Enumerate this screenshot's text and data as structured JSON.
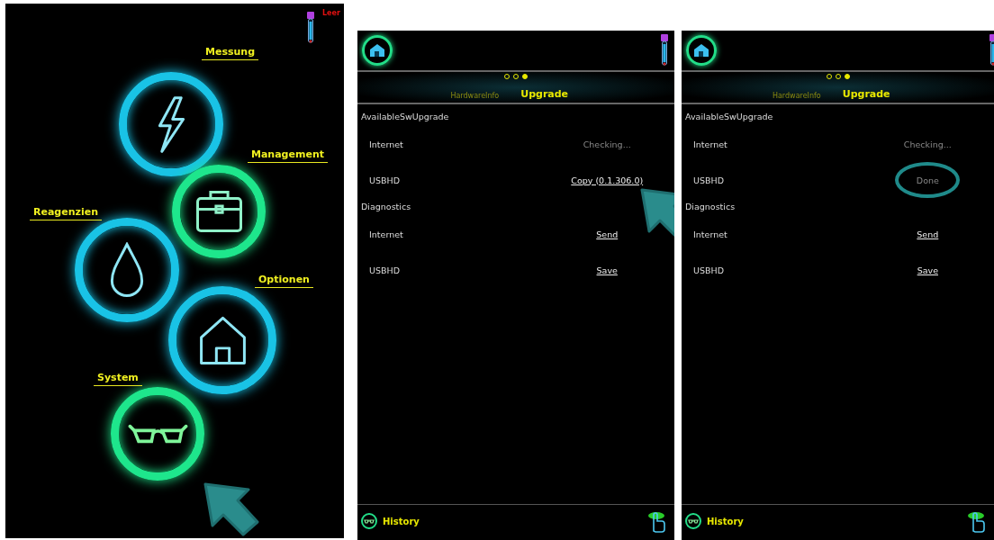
{
  "screens": [
    {
      "kind": "menu",
      "status_label": "Leer",
      "pointer": true,
      "menu": [
        {
          "label": "Messung",
          "color": "#19c3e6"
        },
        {
          "label": "Management",
          "color": "#1ee68c"
        },
        {
          "label": "Reagenzien",
          "color": "#19c3e6"
        },
        {
          "label": "Optionen",
          "color": "#19c3e6"
        },
        {
          "label": "System",
          "color": "#1ee68c"
        }
      ]
    },
    {
      "kind": "upgrade",
      "pager": [
        {
          "selected": false
        },
        {
          "selected": false
        },
        {
          "selected": true
        }
      ],
      "tabs": [
        {
          "label": "HardwareInfo",
          "selected": false
        },
        {
          "label": "Upgrade",
          "selected": true
        }
      ],
      "sections": [
        {
          "title": "AvailableSwUpgrade",
          "rows": [
            {
              "label": "Internet",
              "value": "Checking...",
              "kind": "status",
              "pointed": false,
              "circled": false
            },
            {
              "label": "USBHD",
              "value": "Copy (0.1.306.0)",
              "kind": "link",
              "pointed": true,
              "circled": false
            }
          ]
        },
        {
          "title": "Diagnostics",
          "rows": [
            {
              "label": "Internet",
              "value": "Send",
              "kind": "link",
              "pointed": false,
              "circled": false
            },
            {
              "label": "USBHD",
              "value": "Save",
              "kind": "link",
              "pointed": false,
              "circled": false
            }
          ]
        }
      ],
      "footer": {
        "label": "History"
      }
    },
    {
      "kind": "upgrade",
      "pager": [
        {
          "selected": false
        },
        {
          "selected": false
        },
        {
          "selected": true
        }
      ],
      "tabs": [
        {
          "label": "HardwareInfo",
          "selected": false
        },
        {
          "label": "Upgrade",
          "selected": true
        }
      ],
      "sections": [
        {
          "title": "AvailableSwUpgrade",
          "rows": [
            {
              "label": "Internet",
              "value": "Checking...",
              "kind": "status",
              "pointed": false,
              "circled": false
            },
            {
              "label": "USBHD",
              "value": "Done",
              "kind": "status",
              "pointed": false,
              "circled": true
            }
          ]
        },
        {
          "title": "Diagnostics",
          "rows": [
            {
              "label": "Internet",
              "value": "Send",
              "kind": "link",
              "pointed": false,
              "circled": false
            },
            {
              "label": "USBHD",
              "value": "Save",
              "kind": "link",
              "pointed": false,
              "circled": false
            }
          ]
        }
      ],
      "footer": {
        "label": "History"
      }
    }
  ]
}
